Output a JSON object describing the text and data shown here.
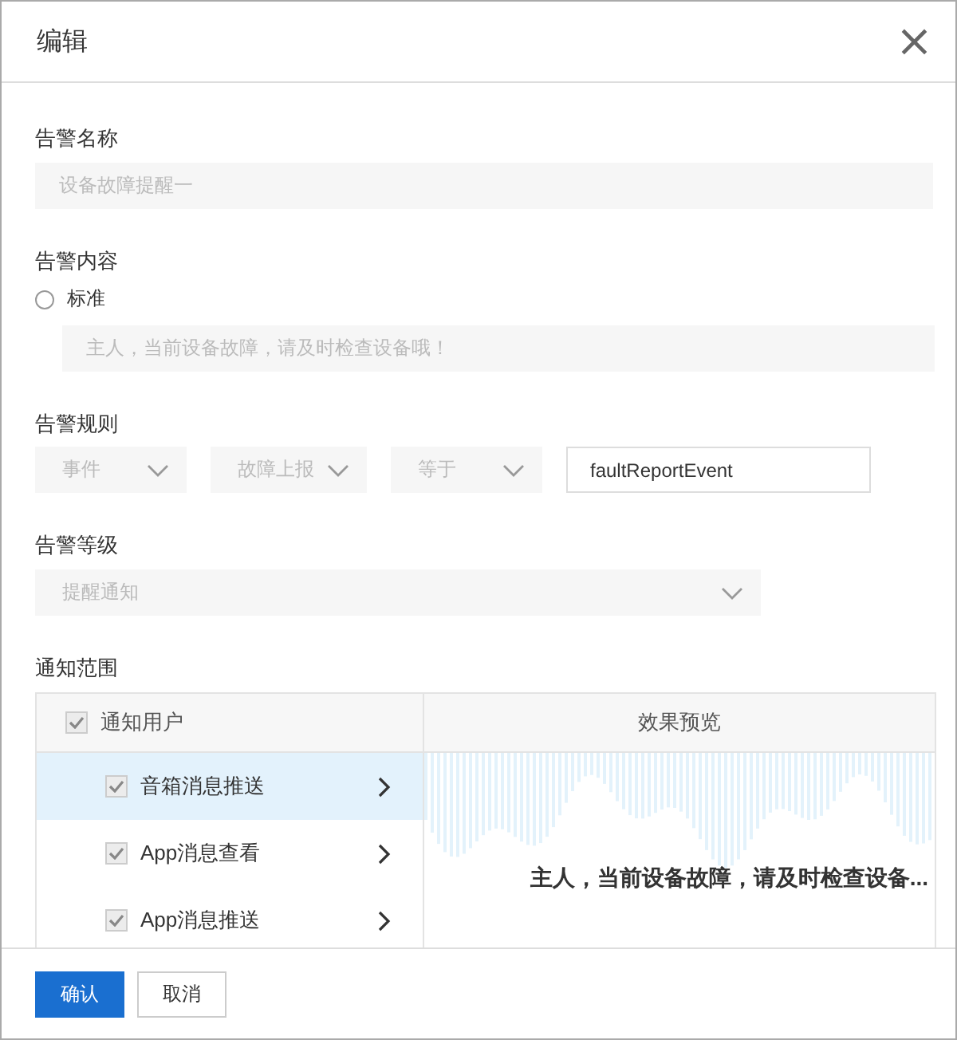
{
  "dialog": {
    "title": "编辑",
    "close": "×"
  },
  "alert_name": {
    "label": "告警名称",
    "value": "设备故障提醒一",
    "disabled": true
  },
  "alert_content": {
    "label": "告警内容",
    "option": {
      "label": "标准",
      "selected": false
    },
    "value": "主人，当前设备故障，请及时检查设备哦！",
    "disabled": true
  },
  "alert_rule": {
    "label": "告警规则",
    "fields": [
      {
        "kind": "select",
        "value": "事件",
        "disabled": true
      },
      {
        "kind": "select",
        "value": "故障上报",
        "disabled": true
      },
      {
        "kind": "select",
        "value": "等于",
        "disabled": true
      },
      {
        "kind": "input",
        "value": "faultReportEvent",
        "disabled": false
      }
    ]
  },
  "alert_level": {
    "label": "告警等级",
    "value": "提醒通知",
    "disabled": true
  },
  "notify_scope": {
    "label": "通知范围",
    "header": {
      "label": "通知用户",
      "checked": true
    },
    "preview_title": "效果预览",
    "items": [
      {
        "label": "音箱消息推送",
        "checked": true,
        "selected": true
      },
      {
        "label": "App消息查看",
        "checked": true,
        "selected": false
      },
      {
        "label": "App消息推送",
        "checked": true,
        "selected": false
      }
    ],
    "preview_text": "主人，当前设备故障，请及时检查设备..."
  },
  "buttons": [
    {
      "label": "确认",
      "kind": "primary"
    },
    {
      "label": "取消",
      "kind": "default"
    }
  ]
}
